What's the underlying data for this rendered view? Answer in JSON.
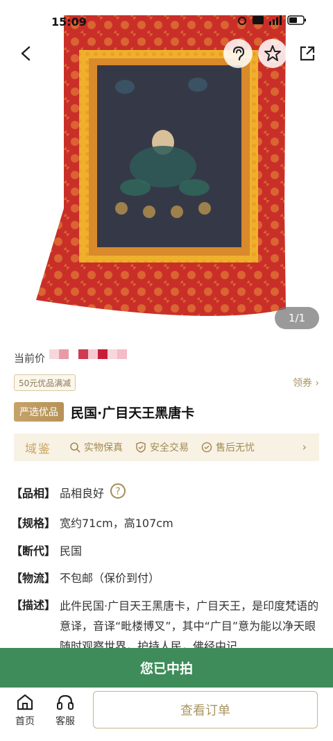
{
  "status": {
    "time": "15:09"
  },
  "hero": {
    "counter": "1/1"
  },
  "price": {
    "label": "当前价"
  },
  "coupon": {
    "text": "50元优品满减",
    "link": "领券 ›"
  },
  "product": {
    "tag": "严选优品",
    "title": "民国·广目天王黑唐卡"
  },
  "guarantee": {
    "brand": "域鉴",
    "items": [
      "实物保真",
      "安全交易",
      "售后无忧"
    ],
    "chevron": "›"
  },
  "attributes": [
    {
      "key": "【品相】",
      "value": "品相良好"
    },
    {
      "key": "【规格】",
      "value": "宽约71cm，高107cm"
    },
    {
      "key": "【断代】",
      "value": "民国"
    },
    {
      "key": "【物流】",
      "value": "不包邮（保价到付）"
    },
    {
      "key": "【描述】",
      "value": "此件民国·广目天王黑唐卡，广目天王，是印度梵语的意译，音译“毗楼博叉”，其中“广目”意为能以净天眼随时观察世界，护持人民，佛经中记"
    }
  ],
  "banner": {
    "text": "您已中拍"
  },
  "bottom_nav": {
    "home": "首页",
    "service": "客服",
    "order_button": "查看订单"
  },
  "colors": {
    "accent_green": "#3d8c5a",
    "gold": "#c5a36a",
    "thangka_red": "#c8302a"
  }
}
